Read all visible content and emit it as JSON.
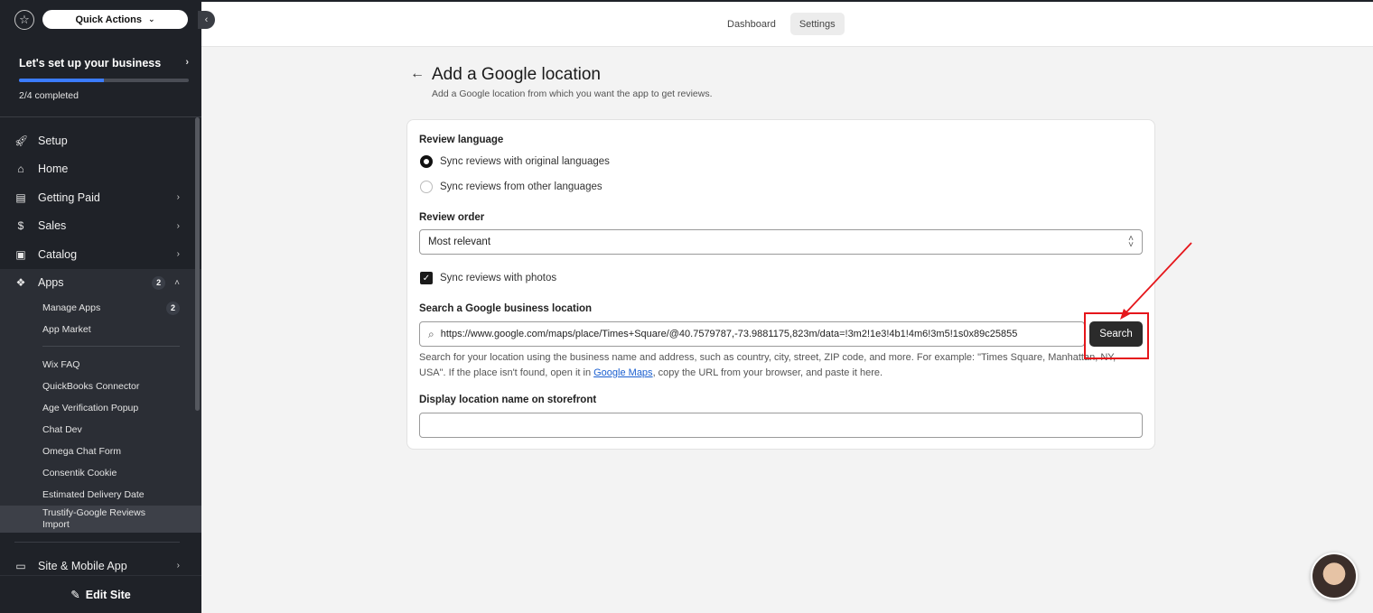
{
  "sidebar": {
    "quick_actions": "Quick Actions",
    "setup": {
      "title": "Let's set up your business",
      "progress_text": "2/4 completed",
      "progress_fraction": 0.5
    },
    "nav": [
      {
        "label": "Setup",
        "icon": "rocket-icon"
      },
      {
        "label": "Home",
        "icon": "home-icon"
      },
      {
        "label": "Getting Paid",
        "icon": "invoice-icon"
      },
      {
        "label": "Sales",
        "icon": "dollar-icon"
      },
      {
        "label": "Catalog",
        "icon": "box-icon"
      },
      {
        "label": "Apps",
        "icon": "apps-icon",
        "badge": "2"
      }
    ],
    "apps_sub": {
      "manage_apps": "Manage Apps",
      "manage_badge": "2",
      "app_market": "App Market",
      "installed": [
        "Wix FAQ",
        "QuickBooks Connector",
        "Age Verification Popup",
        "Chat Dev",
        "Omega Chat Form",
        "Consentik Cookie",
        "Estimated Delivery Date"
      ],
      "selected_line1": "Trustify-Google Reviews",
      "selected_line2": "Import"
    },
    "site_mobile": "Site & Mobile App",
    "edit_site": "Edit Site"
  },
  "topbar": {
    "tabs": [
      "Dashboard",
      "Settings"
    ],
    "active_tab": "Settings"
  },
  "page": {
    "title": "Add a Google location",
    "subtitle": "Add a Google location from which you want the app to get reviews."
  },
  "form": {
    "review_language_label": "Review language",
    "lang_option_1": "Sync reviews with original languages",
    "lang_option_2": "Sync reviews from other languages",
    "review_order_label": "Review order",
    "review_order_value": "Most relevant",
    "sync_photos_label": "Sync reviews with photos",
    "search_label": "Search a Google business location",
    "search_value": "https://www.google.com/maps/place/Times+Square/@40.7579787,-73.9881175,823m/data=!3m2!1e3!4b1!4m6!3m5!1s0x89c25855",
    "search_button": "Search",
    "helper_part1": "Search for your location using the business name and address, such as country, city, street, ZIP code, and more. For example: \"Times Square, Manhattan, NY, USA\". If the place isn't found, open it in ",
    "helper_link": "Google Maps",
    "helper_part2": ", copy the URL from your browser, and paste it here.",
    "display_name_label": "Display location name on storefront",
    "display_name_value": ""
  },
  "colors": {
    "accent": "#3b7cff",
    "annotation": "#e5161b",
    "sidebar_bg": "#1f2228"
  }
}
